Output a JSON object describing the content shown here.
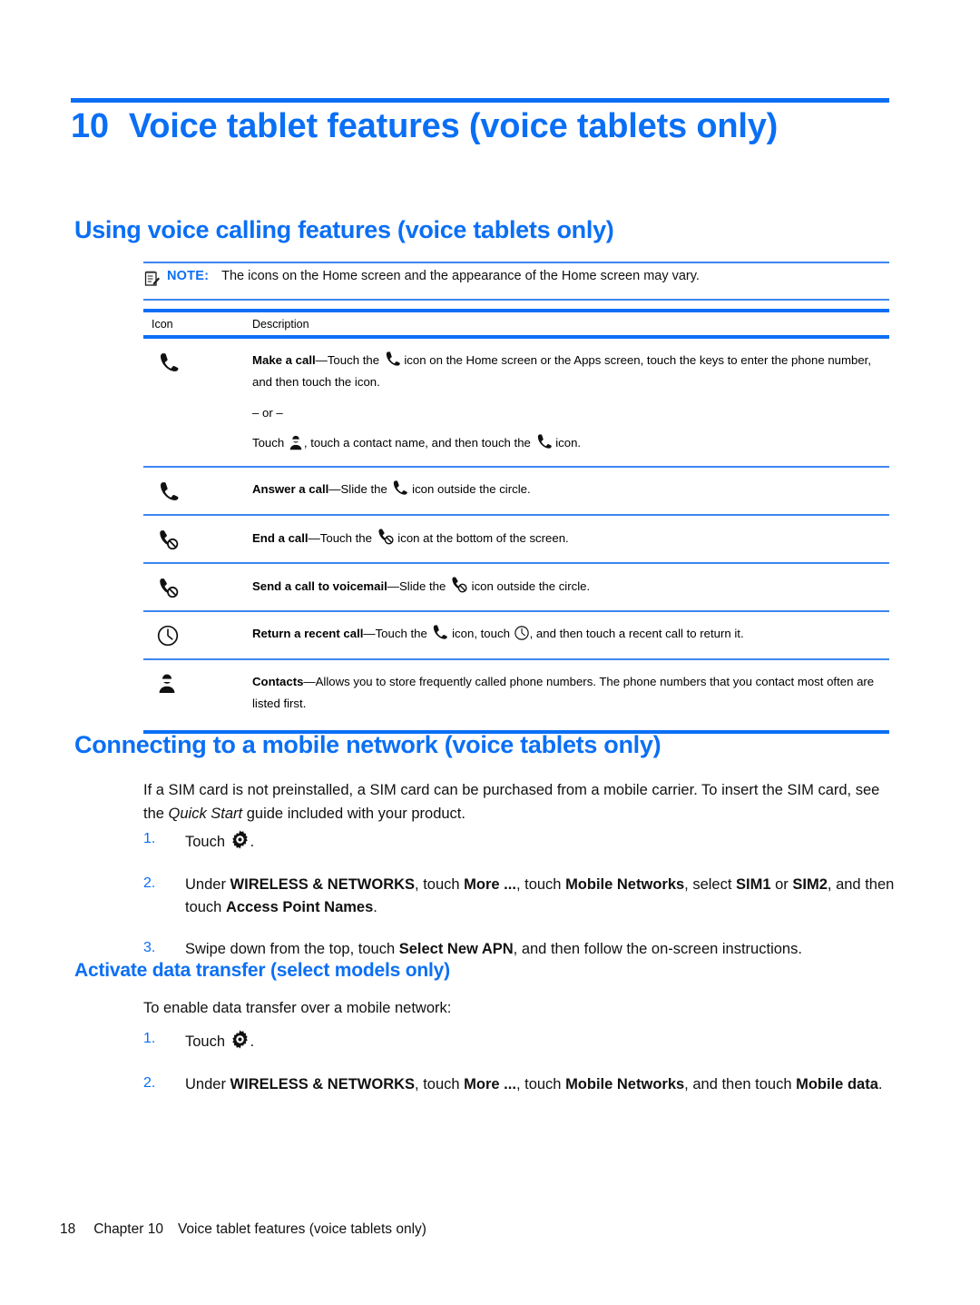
{
  "chapter": {
    "number": "10",
    "title": "Voice tablet features (voice tablets only)"
  },
  "headings": {
    "using_voice_calling": "Using voice calling features (voice tablets only)",
    "connecting_mobile_network": "Connecting to a mobile network (voice tablets only)",
    "activate_data_transfer": "Activate data transfer (select models only)"
  },
  "note": {
    "icon": "note-pencil-icon",
    "label": "NOTE:",
    "text": "The icons on the Home screen and the appearance of the Home screen may vary."
  },
  "icon_table": {
    "headers": {
      "icon": "Icon",
      "description": "Description"
    },
    "rows": [
      {
        "row_icon": "phone-handset-icon",
        "term": "Make a call",
        "dash": "—",
        "line1_a": "Touch the",
        "line1_icon": "phone-handset-icon",
        "line1_b": "icon on the Home screen or the Apps screen, touch the keys to enter the phone number, and then touch the icon.",
        "or_separator": "– or –",
        "line2_a": "Touch",
        "line2_icon": "contact-person-icon",
        "line2_b": ", touch a contact name, and then touch the",
        "line2_icon2": "phone-handset-icon",
        "line2_c": "icon."
      },
      {
        "row_icon": "phone-handset-icon",
        "term": "Answer a call",
        "dash": "—",
        "line1_a": "Slide the",
        "line1_icon": "phone-handset-icon",
        "line1_b": "icon outside the circle."
      },
      {
        "row_icon": "end-call-icon",
        "term": "End a call",
        "dash": "—",
        "line1_a": "Touch the",
        "line1_icon": "end-call-icon",
        "line1_b": "icon at the bottom of the screen."
      },
      {
        "row_icon": "end-call-icon",
        "term": "Send a call to voicemail",
        "dash": "—",
        "line1_a": "Slide the",
        "line1_icon": "end-call-icon",
        "line1_b": "icon outside the circle."
      },
      {
        "row_icon": "clock-icon",
        "term": "Return a recent call",
        "dash": "—",
        "line1_a": "Touch the",
        "line1_icon": "phone-handset-icon",
        "line1_b": "icon, touch",
        "line1_icon2": "clock-icon",
        "line1_c": ", and then touch a recent call to return it."
      },
      {
        "row_icon": "contact-person-icon",
        "term": "Contacts",
        "dash": "—",
        "line1_a": "Allows you to store frequently called phone numbers. The phone numbers that you contact most often are listed first."
      }
    ]
  },
  "connecting_section": {
    "intro_a": "If a SIM card is not preinstalled, a SIM card can be purchased from a mobile carrier. To insert the SIM card, see the",
    "intro_italic": "Quick Start",
    "intro_b": "guide included with your product.",
    "steps": [
      {
        "num": "1.",
        "text_a": "Touch",
        "icon": "settings-gear-icon",
        "text_b": "."
      },
      {
        "num": "2.",
        "t1": "Under ",
        "b1": "WIRELESS & NETWORKS",
        "t2": ", touch ",
        "b2": "More ...",
        "t3": ", touch ",
        "b3": "Mobile Networks",
        "t4": ", select ",
        "b4": "SIM1",
        "t5": " or ",
        "b5": "SIM2",
        "t6": ", and then touch ",
        "b6": "Access Point Names",
        "t7": "."
      },
      {
        "num": "3.",
        "t1": "Swipe down from the top, touch ",
        "b1": "Select New APN",
        "t2": ", and then follow the on-screen instructions."
      }
    ]
  },
  "activate_section": {
    "intro": "To enable data transfer over a mobile network:",
    "steps": [
      {
        "num": "1.",
        "text_a": "Touch",
        "icon": "settings-gear-icon",
        "text_b": "."
      },
      {
        "num": "2.",
        "t1": "Under ",
        "b1": "WIRELESS & NETWORKS",
        "t2": ", touch ",
        "b2": "More ...",
        "t3": ", touch ",
        "b3": "Mobile Networks",
        "t4": ", and then touch ",
        "b4": "Mobile data",
        "t5": "."
      }
    ]
  },
  "footer": {
    "page_number": "18",
    "chapter_label": "Chapter 10",
    "chapter_title": "Voice tablet features (voice tablets only)"
  },
  "colors": {
    "accent_blue": "#0b6ff5",
    "rule_blue": "#3d86f0",
    "body_text": "#111111"
  }
}
